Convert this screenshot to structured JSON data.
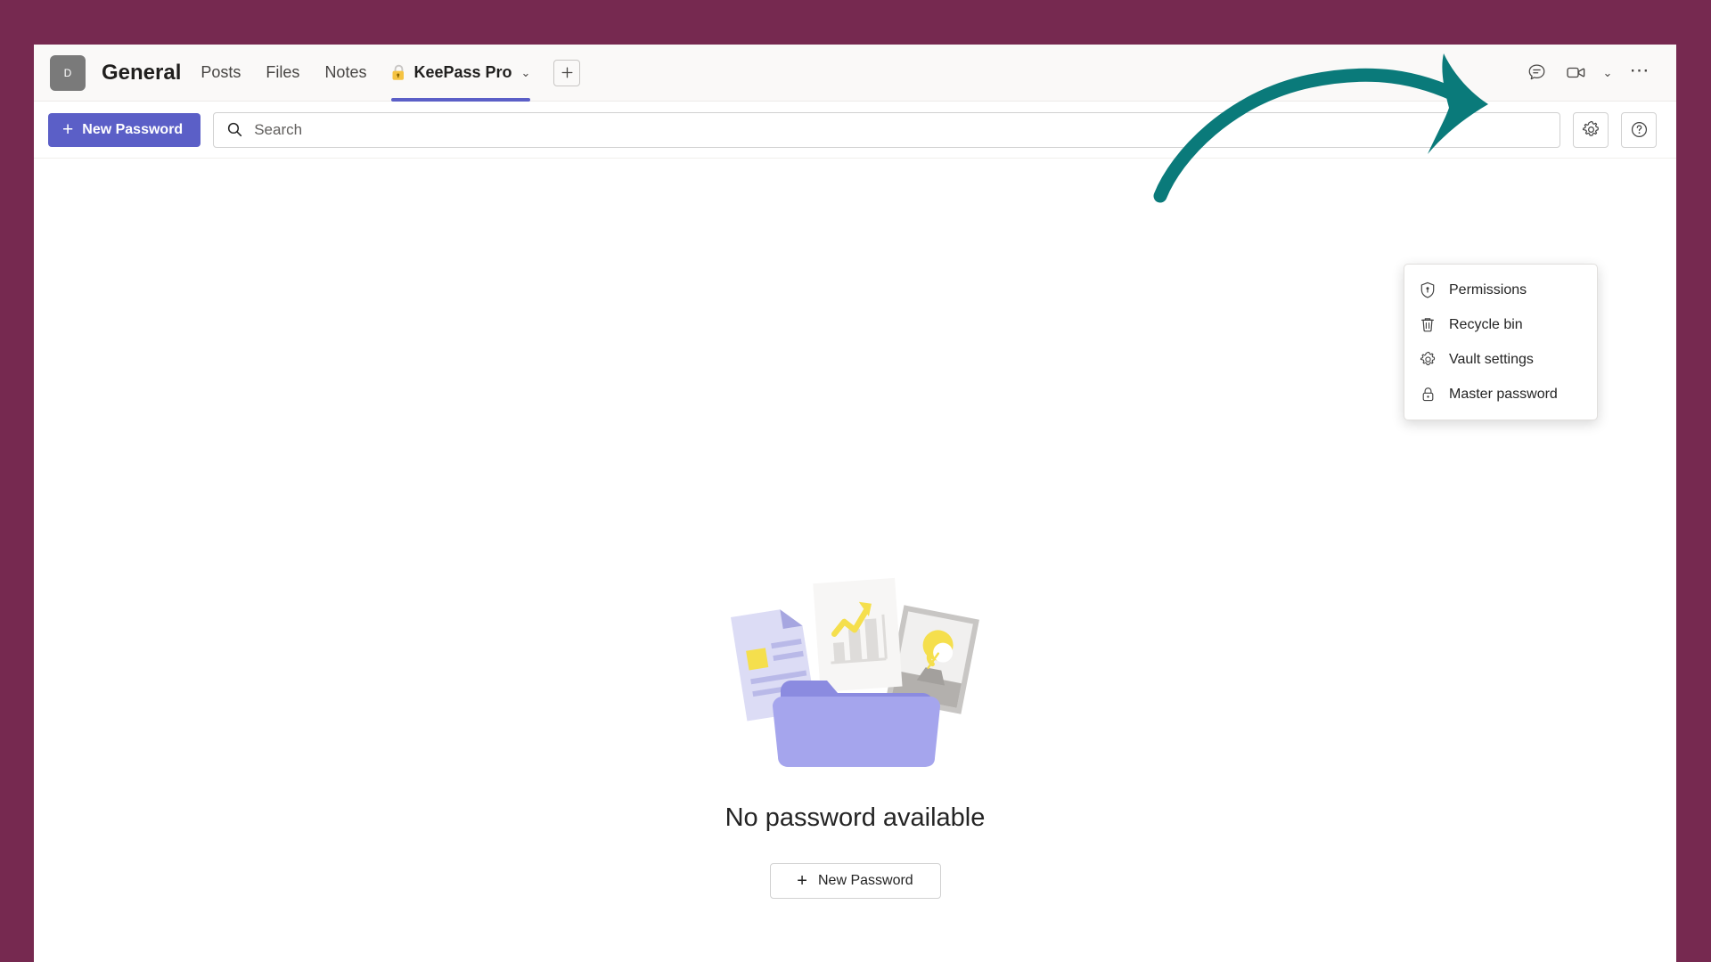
{
  "window": {
    "background_color": "#762950",
    "surface_color": "#faf9f8"
  },
  "header": {
    "avatar_initial": "D",
    "channel_title": "General",
    "tabs": [
      {
        "label": "Posts",
        "active": false,
        "icon": null
      },
      {
        "label": "Files",
        "active": false,
        "icon": null
      },
      {
        "label": "Notes",
        "active": false,
        "icon": null
      },
      {
        "label": "KeePass Pro",
        "active": true,
        "icon": "lock-icon",
        "chevron": "⌄"
      }
    ],
    "add_tab_label": "+",
    "right_icons": [
      {
        "name": "chat-icon",
        "label": "Chat"
      },
      {
        "name": "video-camera-icon",
        "label": "Meet now"
      },
      {
        "name": "chevron-down-icon",
        "label": "⌄"
      },
      {
        "name": "more-options-icon",
        "label": "⋯"
      }
    ]
  },
  "toolbar": {
    "new_password_label": "New Password",
    "new_password_color": "#5b5fc7",
    "search_placeholder": "Search",
    "search_value": "",
    "search_icon": "search-icon",
    "settings_icon": "gear-icon",
    "help_icon": "help-circle-icon"
  },
  "menu": {
    "visible": true,
    "items": [
      {
        "label": "Permissions",
        "icon": "shield-icon"
      },
      {
        "label": "Recycle bin",
        "icon": "trash-icon"
      },
      {
        "label": "Vault settings",
        "icon": "gear-icon"
      },
      {
        "label": "Master password",
        "icon": "lock-icon"
      }
    ]
  },
  "empty_state": {
    "illustration": "folder-with-documents-illustration",
    "title": "No password available",
    "button_label": "New Password"
  },
  "annotation": {
    "type": "curved-arrow",
    "color": "#0a7a7a",
    "points_to": "gear-icon"
  }
}
